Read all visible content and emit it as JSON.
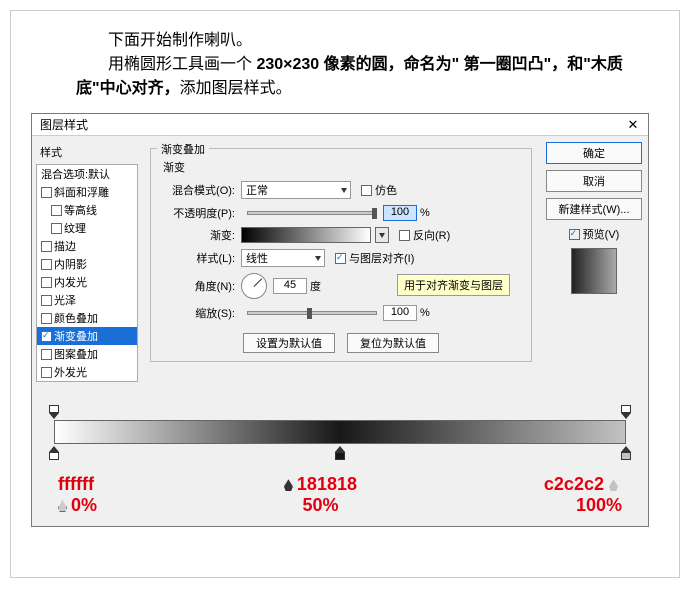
{
  "doc": {
    "line1": "下面开始制作喇叭。",
    "line2_pre": "用椭圆形工具画一个 ",
    "line2_bold1": "230×230 像素的圆，命名为\" 第一圈凹凸\"，和\"木质底\"中心对齐，",
    "line2_post": "添加图层样式。"
  },
  "dialog": {
    "title": "图层样式",
    "left_label": "样式",
    "blend_options": "混合选项:默认",
    "items": [
      {
        "label": "斜面和浮雕",
        "checked": false
      },
      {
        "label": "等高线",
        "checked": false,
        "indent": true
      },
      {
        "label": "纹理",
        "checked": false,
        "indent": true
      },
      {
        "label": "描边",
        "checked": false
      },
      {
        "label": "内阴影",
        "checked": false
      },
      {
        "label": "内发光",
        "checked": false
      },
      {
        "label": "光泽",
        "checked": false
      },
      {
        "label": "颜色叠加",
        "checked": false
      },
      {
        "label": "渐变叠加",
        "checked": true,
        "selected": true
      },
      {
        "label": "图案叠加",
        "checked": false
      },
      {
        "label": "外发光",
        "checked": false
      }
    ],
    "group_title": "渐变叠加",
    "sub_title": "渐变",
    "blend_mode_label": "混合模式(O):",
    "blend_mode_value": "正常",
    "dither_label": "仿色",
    "opacity_label": "不透明度(P):",
    "opacity_value": "100",
    "gradient_label": "渐变:",
    "reverse_label": "反向(R)",
    "style_label": "样式(L):",
    "style_value": "线性",
    "align_label": "与图层对齐(I)",
    "angle_label": "角度(N):",
    "angle_value": "45",
    "angle_unit": "度",
    "scale_label": "缩放(S):",
    "scale_value": "100",
    "set_default": "设置为默认值",
    "reset_default": "复位为默认值",
    "ok": "确定",
    "cancel": "取消",
    "new_style": "新建样式(W)...",
    "preview": "预览(V)",
    "tooltip": "用于对齐渐变与图层"
  },
  "gradient": {
    "stops": [
      {
        "color": "ffffff",
        "pos": "0%"
      },
      {
        "color": "181818",
        "pos": "50%"
      },
      {
        "color": "c2c2c2",
        "pos": "100%"
      }
    ]
  }
}
